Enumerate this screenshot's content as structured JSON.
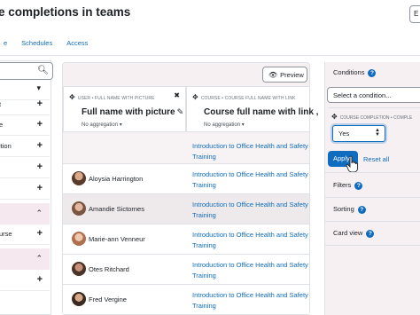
{
  "page": {
    "title": "e completions in teams",
    "edit_label": "E"
  },
  "tabs": [
    "e",
    "Schedules",
    "Access"
  ],
  "left": {
    "search_icon": "search-icon",
    "items": [
      "",
      "t",
      "e",
      "ition",
      "",
      "",
      "urse",
      ""
    ]
  },
  "main": {
    "preview_label": "Preview",
    "columns": [
      {
        "meta": "USER • FULL NAME WITH PICTURE",
        "heading": "Full name with picture",
        "aggregation": "No aggregation"
      },
      {
        "meta": "COURSE • COURSE FULL NAME WITH LINK",
        "heading": "Course full name with link ,",
        "aggregation": "No aggregation"
      }
    ],
    "rows": [
      {
        "name": "",
        "course": "Introduction to Office Health and Safety Training"
      },
      {
        "name": "Aloysia Harrington",
        "course": "Introduction to Office Health and Safety Training"
      },
      {
        "name": "Amandie Sictornes",
        "course": "Introduction to Office Health and Safety Training"
      },
      {
        "name": "Marie-ann Venneur",
        "course": "Introduction to Office Health and Safety Training"
      },
      {
        "name": "Otes Ritchard",
        "course": "Introduction to Office Health and Safety Training"
      },
      {
        "name": "Fred Vergine",
        "course": "Introduction to Office Health and Safety Training"
      }
    ]
  },
  "right": {
    "conditions_label": "Conditions",
    "select_placeholder": "Select a condition...",
    "condition_meta": "COURSE COMPLETION • COMPLE",
    "condition_value": "Yes",
    "apply_label": "Apply",
    "reset_label": "Reset all",
    "filters_label": "Filters",
    "sorting_label": "Sorting",
    "cardview_label": "Card view"
  },
  "colors": {
    "accent": "#0f6cbf",
    "panel_bg": "#f6f0f3"
  }
}
